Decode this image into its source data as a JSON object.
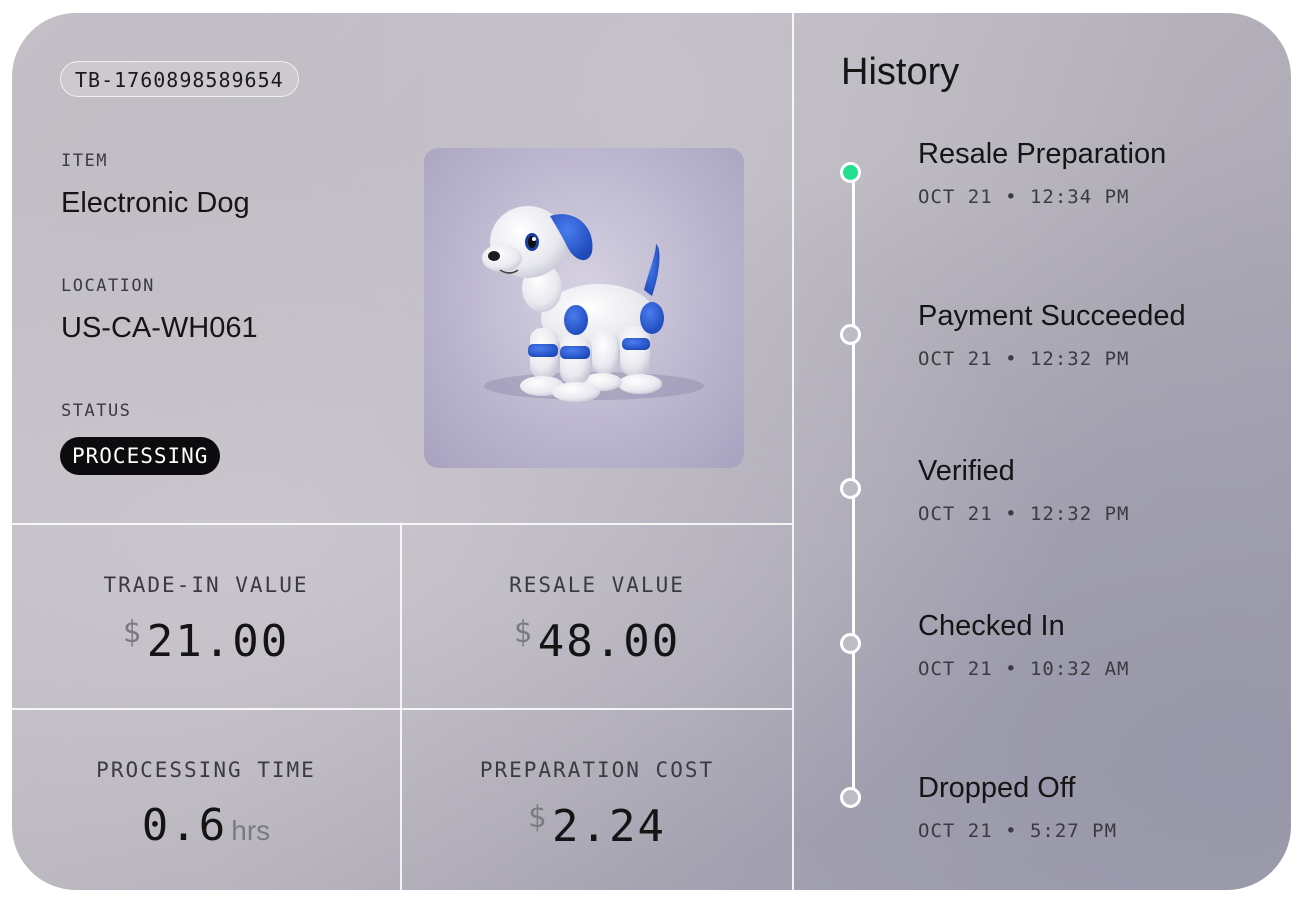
{
  "ticket_id": "TB-1760898589654",
  "item": {
    "label": "ITEM",
    "value": "Electronic Dog"
  },
  "location": {
    "label": "LOCATION",
    "value": "US-CA-WH061"
  },
  "status": {
    "label": "STATUS",
    "value": "PROCESSING"
  },
  "image_alt": "Electronic Dog",
  "metrics": {
    "trade_in": {
      "label": "TRADE-IN VALUE",
      "currency": "$",
      "value": "21.00"
    },
    "resale": {
      "label": "RESALE VALUE",
      "currency": "$",
      "value": "48.00"
    },
    "processing_time": {
      "label": "PROCESSING TIME",
      "value": "0.6",
      "unit": "hrs"
    },
    "prep_cost": {
      "label": "PREPARATION COST",
      "currency": "$",
      "value": "2.24"
    }
  },
  "history": {
    "title": "History",
    "events": [
      {
        "title": "Resale Preparation",
        "time": "OCT 21 • 12:34 PM",
        "active": true
      },
      {
        "title": "Payment Succeeded",
        "time": "OCT 21 • 12:32 PM",
        "active": false
      },
      {
        "title": "Verified",
        "time": "OCT 21 • 12:32 PM",
        "active": false
      },
      {
        "title": "Checked In",
        "time": "OCT 21 • 10:32 AM",
        "active": false
      },
      {
        "title": "Dropped Off",
        "time": "OCT 21 • 5:27 PM",
        "active": false
      }
    ]
  },
  "colors": {
    "active_dot": "#22e090",
    "status_pill": "#0c0c0e"
  }
}
